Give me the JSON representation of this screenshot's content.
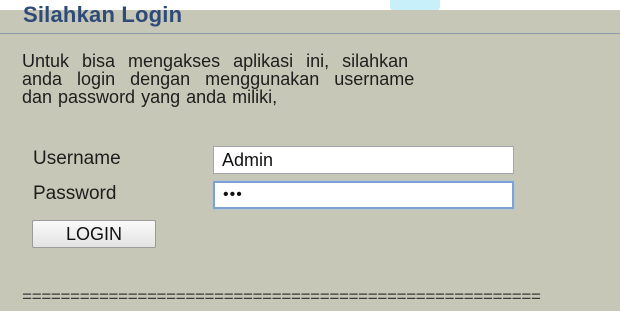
{
  "login_panel": {
    "title": "Silahkan Login",
    "intro_lines": [
      "Untuk bisa mengakses aplikasi ini, silahkan",
      "anda login dengan menggunakan username",
      "dan password yang anda miliki,"
    ],
    "username": {
      "label": "Username",
      "value": "Admin"
    },
    "password": {
      "label": "Password",
      "masked_value": "•••"
    },
    "login_button_label": "LOGIN",
    "divider_text": "======================================================"
  },
  "colors": {
    "panel_background": "#c7c7b7",
    "title": "#2e4b78",
    "focus_border": "#7ea2d6"
  }
}
